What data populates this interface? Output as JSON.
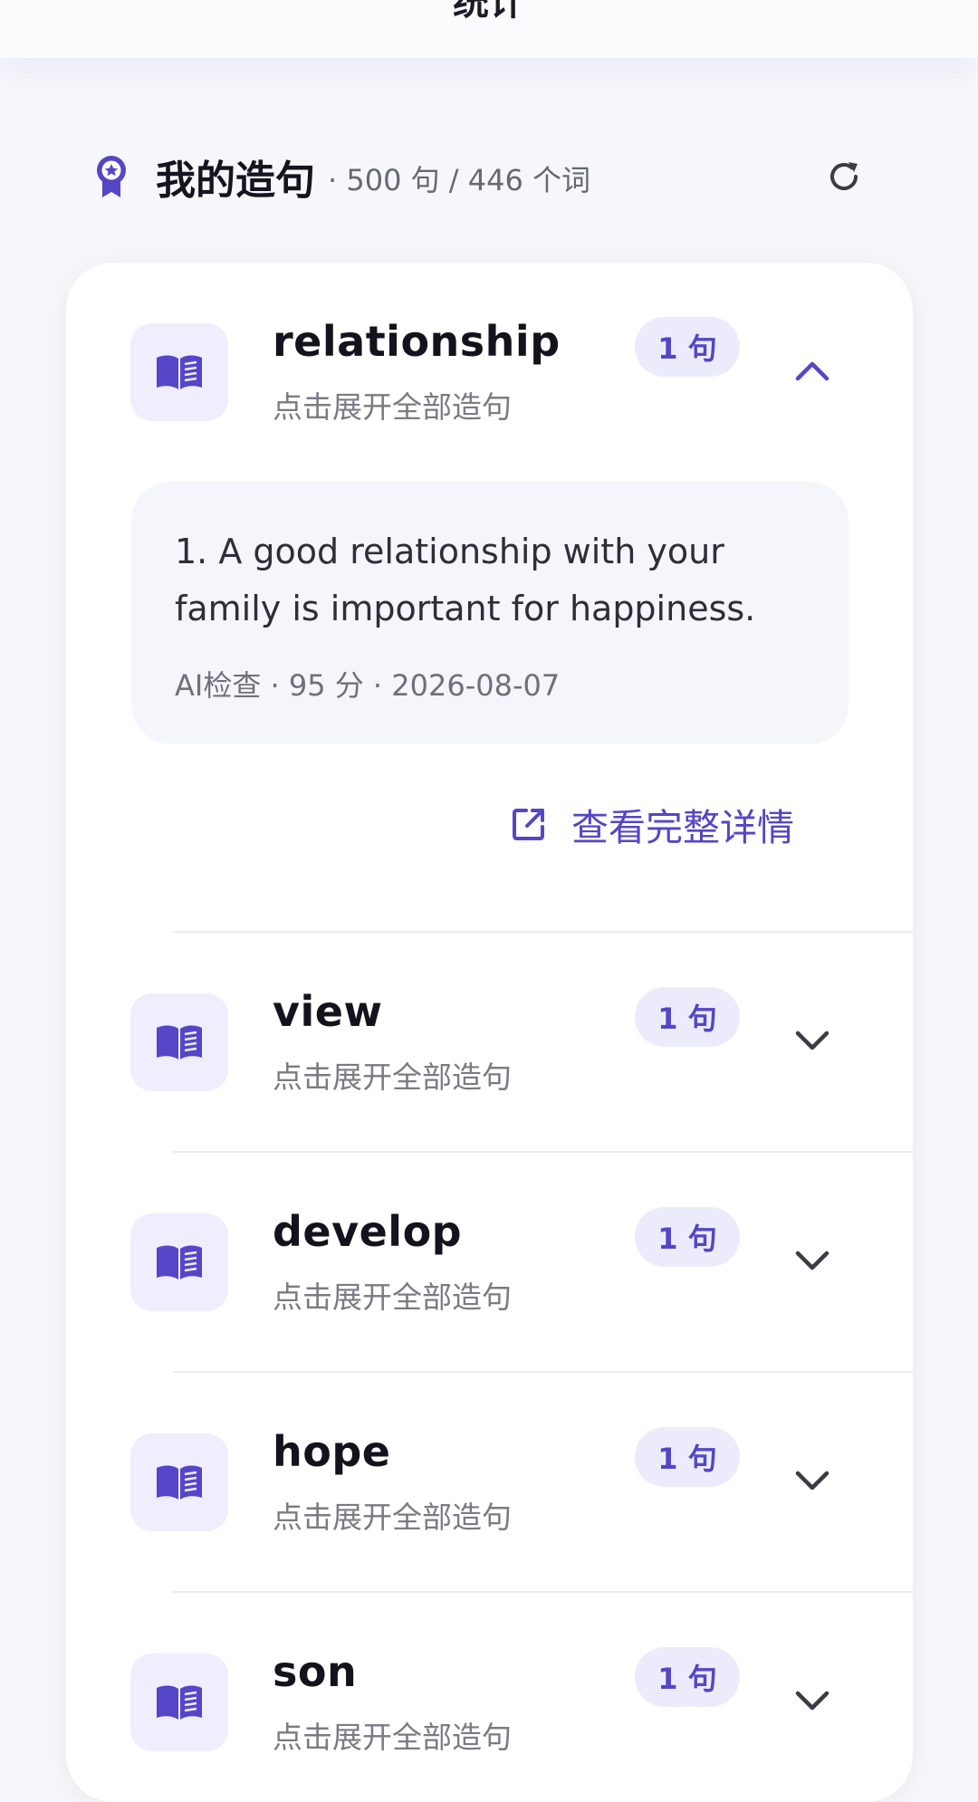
{
  "topbar": {
    "title": "统计"
  },
  "section": {
    "title": "我的造句",
    "stats": "· 500 句 / 446 个词"
  },
  "words": [
    {
      "word": "relationship",
      "hint": "点击展开全部造句",
      "count": "1 句",
      "expanded": true,
      "sentence": "1. A good relationship with your family is important for happiness.",
      "meta": "AI检查 · 95 分 · 2026-08-07",
      "detail_label": "查看完整详情"
    },
    {
      "word": "view",
      "hint": "点击展开全部造句",
      "count": "1 句",
      "expanded": false
    },
    {
      "word": "develop",
      "hint": "点击展开全部造句",
      "count": "1 句",
      "expanded": false
    },
    {
      "word": "hope",
      "hint": "点击展开全部造句",
      "count": "1 句",
      "expanded": false
    },
    {
      "word": "son",
      "hint": "点击展开全部造句",
      "count": "1 句",
      "expanded": false
    }
  ],
  "colors": {
    "accent": "#5446c7",
    "badge_bg": "#ecebfc",
    "icon_bg": "#efedfe",
    "page_bg": "#f7f7fb"
  },
  "icons": {
    "section": "award-ribbon-icon",
    "refresh": "refresh-icon",
    "word": "open-book-icon",
    "expanded": "chevron-up-icon",
    "collapsed": "chevron-down-icon",
    "detail": "external-link-icon"
  }
}
